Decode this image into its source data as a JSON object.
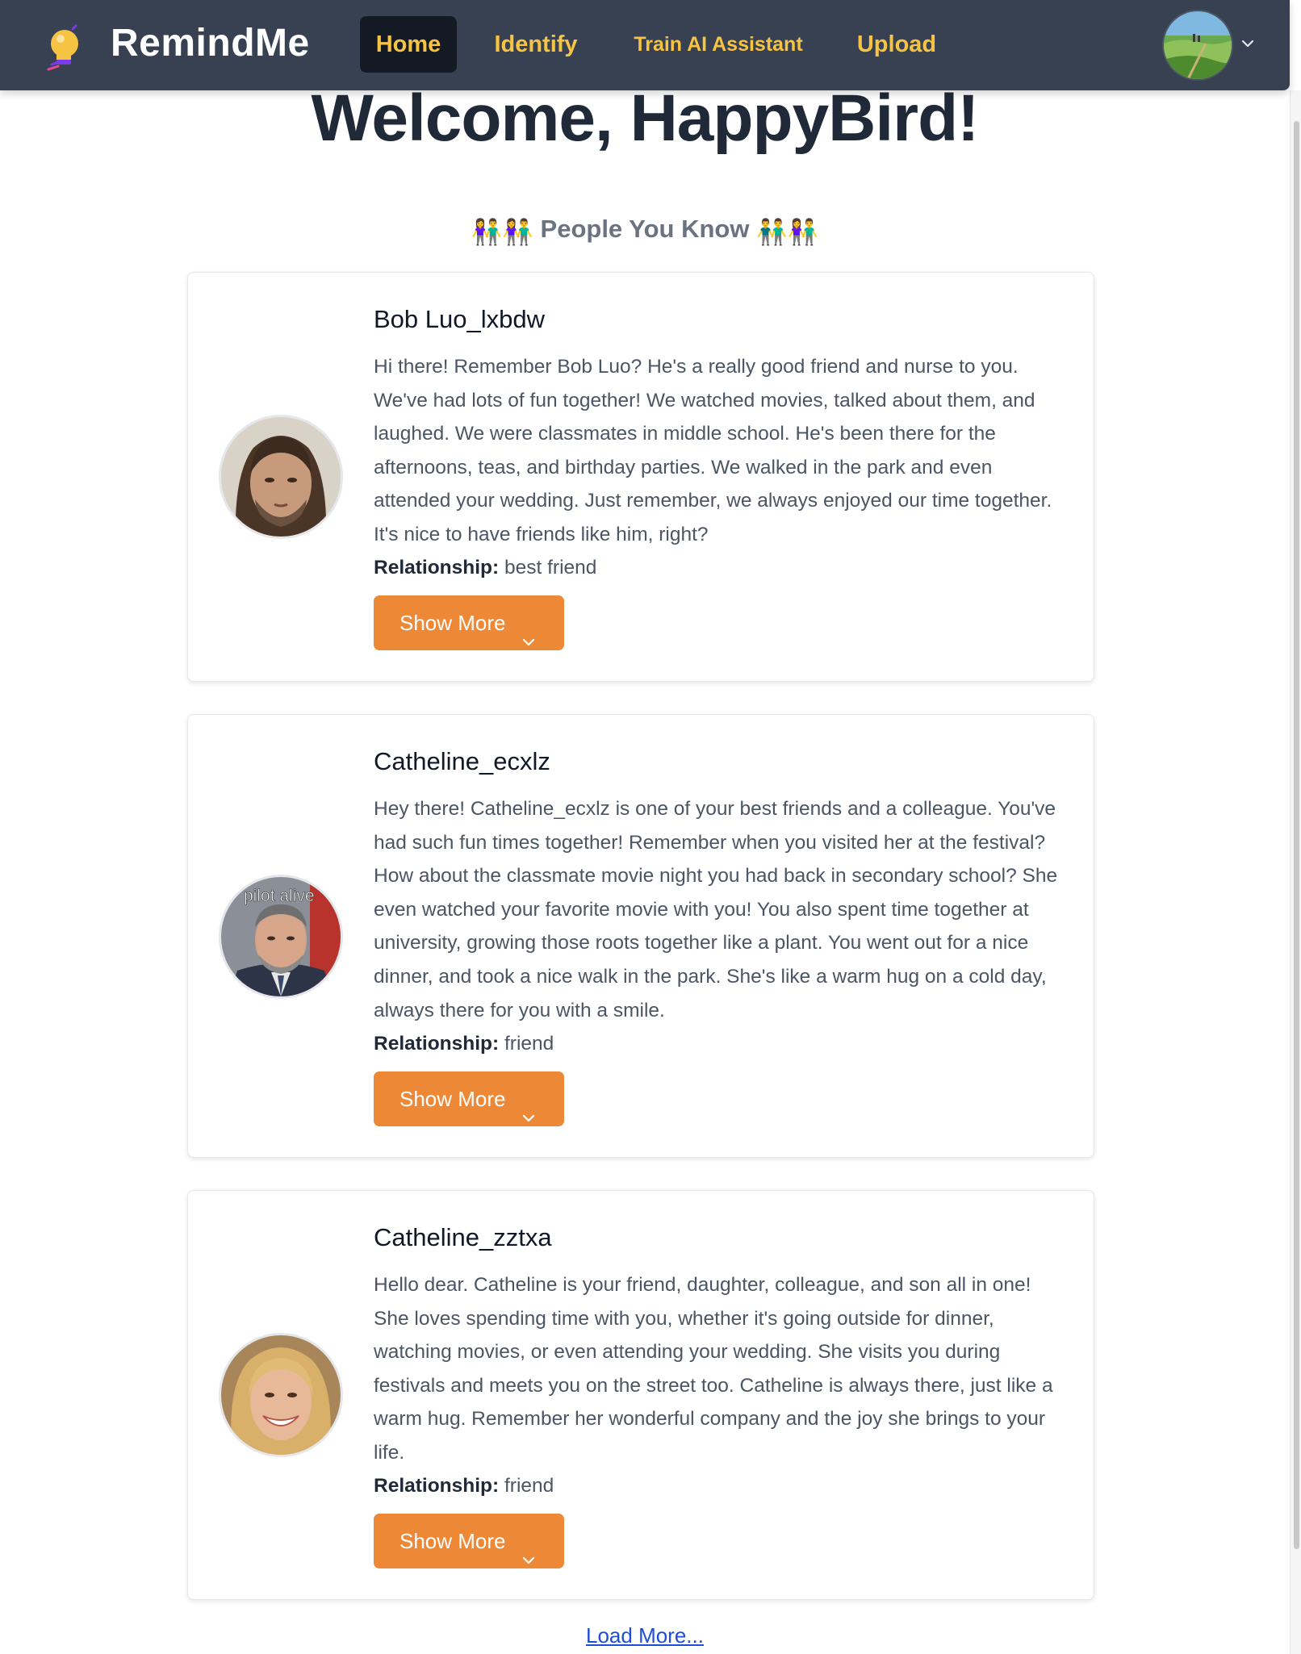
{
  "nav": {
    "brand": "RemindMe",
    "logo_icon": "lightbulb-icon",
    "items": [
      {
        "label": "Home",
        "active": true
      },
      {
        "label": "Identify",
        "active": false
      },
      {
        "label": "Train AI Assistant",
        "active": false
      },
      {
        "label": "Upload",
        "active": false
      }
    ],
    "avatar_icon": "user-avatar",
    "menu_icon": "chevron-down-icon"
  },
  "welcome": "Welcome, HappyBird!",
  "people_heading": {
    "label": "People You Know",
    "left_emoji": "👫👫",
    "right_emoji": "👬👫"
  },
  "people": [
    {
      "name": "Bob Luo_lxbdw",
      "description": "Hi there! Remember Bob Luo? He's a really good friend and nurse to you. We've had lots of fun together! We watched movies, talked about them, and laughed. We were classmates in middle school. He's been there for the afternoons, teas, and birthday parties. We walked in the park and even attended your wedding. Just remember, we always enjoyed our time together. It's nice to have friends like him, right?",
      "relationship_label": "Relationship:",
      "relationship": "best friend",
      "button": "Show More"
    },
    {
      "name": "Catheline_ecxlz",
      "description": "Hey there! Catheline_ecxlz is one of your best friends and a colleague. You've had such fun times together! Remember when you visited her at the festival? How about the classmate movie night you had back in secondary school? She even watched your favorite movie with you! You also spent time together at university, growing those roots together like a plant. You went out for a nice dinner, and took a nice walk in the park. She's like a warm hug on a cold day, always there for you with a smile.",
      "relationship_label": "Relationship:",
      "relationship": "friend",
      "button": "Show More",
      "photo_caption": "pilot alive"
    },
    {
      "name": "Catheline_zztxa",
      "description": "Hello dear. Catheline is your friend, daughter, colleague, and son all in one! She loves spending time with you, whether it's going outside for dinner, watching movies, or even attending your wedding. She visits you during festivals and meets you on the street too. Catheline is always there, just like a warm hug. Remember her wonderful company and the joy she brings to your life.",
      "relationship_label": "Relationship:",
      "relationship": "friend",
      "button": "Show More"
    }
  ],
  "load_more": "Load More...",
  "colors": {
    "navbar": "#374151",
    "nav_text": "#f6c343",
    "button": "#ed8936",
    "link": "#1d4ed8"
  }
}
